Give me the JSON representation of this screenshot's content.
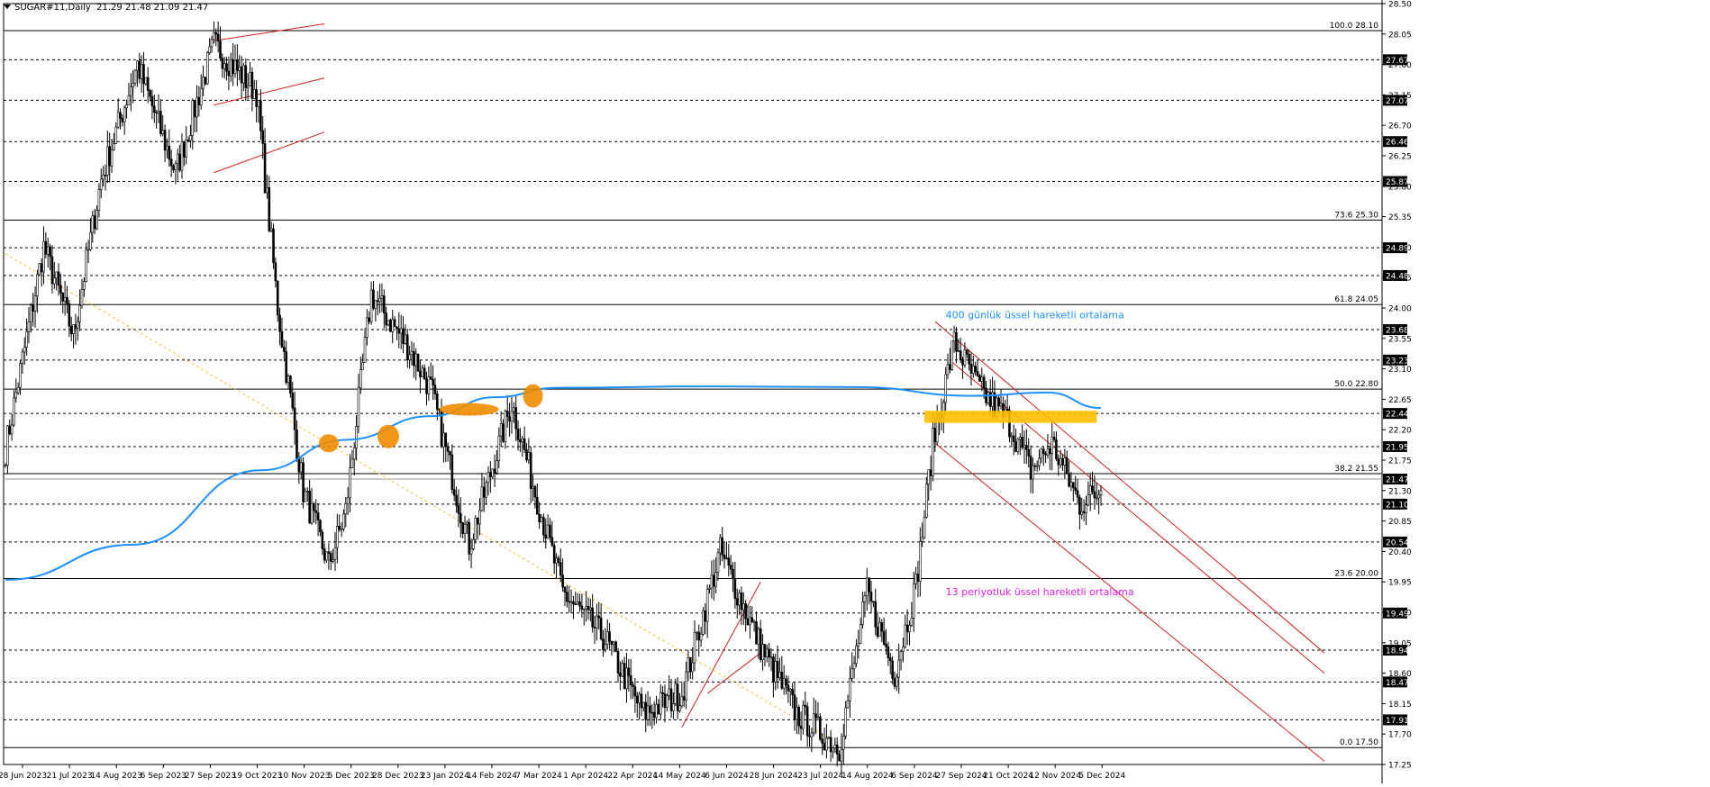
{
  "header": {
    "symbol_label": "SUGAR#11,Daily",
    "ohlc_label": "21.29 21.48 21.09 21.47"
  },
  "colors": {
    "background": "#ffffff",
    "candle": "#000000",
    "ema400": "#1e90ff",
    "ema13_label": "#e020e0",
    "channel": "#cc2222",
    "zone": "#ffc000",
    "highlight": "#f08c00",
    "trend": "#f0c040",
    "current_price_tag": "#000000"
  },
  "chart_data": {
    "type": "candlestick",
    "title": "",
    "symbol": "SUGAR#11",
    "timeframe": "Daily",
    "ylim": [
      17.25,
      28.5
    ],
    "price_ticks": [
      "28.50",
      "28.05",
      "27.60",
      "27.15",
      "26.70",
      "26.25",
      "25.80",
      "25.35",
      "24.90",
      "24.45",
      "24.00",
      "23.55",
      "23.10",
      "22.65",
      "22.20",
      "21.75",
      "21.30",
      "20.85",
      "20.40",
      "19.95",
      "19.50",
      "19.05",
      "18.60",
      "18.15",
      "17.70",
      "17.25"
    ],
    "date_ticks": [
      "28 Jun 2023",
      "21 Jul 2023",
      "14 Aug 2023",
      "6 Sep 2023",
      "27 Sep 2023",
      "19 Oct 2023",
      "10 Nov 2023",
      "5 Dec 2023",
      "28 Dec 2023",
      "23 Jan 2024",
      "14 Feb 2024",
      "7 Mar 2024",
      "1 Apr 2024",
      "22 Apr 2024",
      "14 May 2024",
      "6 Jun 2024",
      "28 Jun 2024",
      "23 Jul 2024",
      "14 Aug 2024",
      "6 Sep 2024",
      "27 Sep 2024",
      "21 Oct 2024",
      "12 Nov 2024",
      "5 Dec 2024"
    ],
    "fibonacci": [
      {
        "level": "100.0",
        "price": 28.1
      },
      {
        "level": "73.6",
        "price": 25.3
      },
      {
        "level": "61.8",
        "price": 24.05
      },
      {
        "level": "50.0",
        "price": 22.8
      },
      {
        "level": "38.2",
        "price": 21.55
      },
      {
        "level": "23.6",
        "price": 20.0
      },
      {
        "level": "0.0",
        "price": 17.5
      }
    ],
    "horizontal_levels": [
      27.67,
      27.07,
      26.46,
      25.87,
      24.89,
      24.48,
      23.68,
      23.23,
      22.44,
      21.95,
      21.1,
      20.54,
      19.49,
      18.94,
      18.47,
      17.91
    ],
    "current_price": 21.47,
    "annotations": {
      "ema400": "400 günlük üssel hareketli ortalama",
      "ema13": "13 periyotluk üssel hareketli ortalama"
    },
    "key_path": [
      [
        0,
        21.9
      ],
      [
        18,
        24.9
      ],
      [
        32,
        23.6
      ],
      [
        45,
        25.9
      ],
      [
        62,
        27.6
      ],
      [
        80,
        26.0
      ],
      [
        98,
        27.9
      ],
      [
        118,
        27.2
      ],
      [
        128,
        24.0
      ],
      [
        140,
        21.3
      ],
      [
        152,
        20.2
      ],
      [
        160,
        21.0
      ],
      [
        172,
        24.2
      ],
      [
        190,
        23.4
      ],
      [
        200,
        22.8
      ],
      [
        218,
        20.5
      ],
      [
        238,
        22.6
      ],
      [
        248,
        21.4
      ],
      [
        262,
        19.8
      ],
      [
        282,
        19.1
      ],
      [
        300,
        18.0
      ],
      [
        318,
        18.3
      ],
      [
        336,
        20.4
      ],
      [
        355,
        19.0
      ],
      [
        372,
        18.0
      ],
      [
        384,
        17.7
      ],
      [
        392,
        17.5
      ],
      [
        405,
        19.8
      ],
      [
        418,
        18.6
      ],
      [
        428,
        19.9
      ],
      [
        436,
        22.0
      ],
      [
        446,
        23.5
      ],
      [
        458,
        22.8
      ],
      [
        472,
        22.3
      ],
      [
        482,
        21.6
      ],
      [
        492,
        22.0
      ],
      [
        505,
        21.1
      ],
      [
        515,
        21.3
      ]
    ],
    "ema400_path": [
      [
        0,
        19.98
      ],
      [
        60,
        20.5
      ],
      [
        120,
        21.6
      ],
      [
        160,
        22.05
      ],
      [
        200,
        22.4
      ],
      [
        230,
        22.68
      ],
      [
        260,
        22.82
      ],
      [
        330,
        22.84
      ],
      [
        400,
        22.83
      ],
      [
        455,
        22.7
      ],
      [
        490,
        22.75
      ],
      [
        515,
        22.52
      ]
    ]
  }
}
